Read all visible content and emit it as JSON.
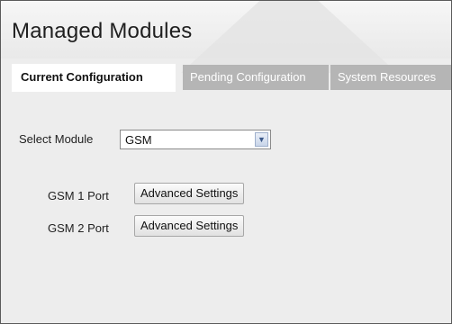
{
  "title": "Managed Modules",
  "tabs": [
    {
      "label": "Current Configuration",
      "active": true
    },
    {
      "label": "Pending Configuration",
      "active": false
    },
    {
      "label": "System Resources",
      "active": false
    }
  ],
  "module_select": {
    "label": "Select Module",
    "value": "GSM"
  },
  "ports": [
    {
      "label": "GSM 1 Port",
      "button": "Advanced Settings"
    },
    {
      "label": "GSM 2 Port",
      "button": "Advanced Settings"
    }
  ],
  "colors": {
    "tab_inactive": "#b5b5b5",
    "background": "#ededed"
  }
}
